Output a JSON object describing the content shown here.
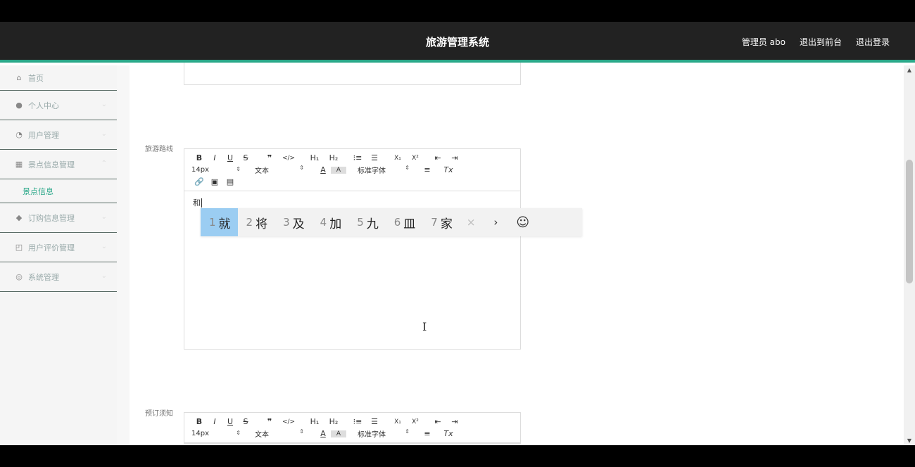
{
  "header": {
    "title": "旅游管理系统",
    "user": "管理员 abo",
    "to_front": "退出到前台",
    "logout": "退出登录"
  },
  "sidebar": {
    "items": [
      {
        "label": "首页",
        "icon": "home-icon",
        "glyph": "⌂"
      },
      {
        "label": "个人中心",
        "icon": "user-icon",
        "glyph": "●"
      },
      {
        "label": "用户管理",
        "icon": "users-icon",
        "glyph": "◔"
      },
      {
        "label": "景点信息管理",
        "icon": "scenic-icon",
        "glyph": "▦"
      },
      {
        "label": "订购信息管理",
        "icon": "order-icon",
        "glyph": "◆"
      },
      {
        "label": "用户评价管理",
        "icon": "review-icon",
        "glyph": "◰"
      },
      {
        "label": "系统管理",
        "icon": "settings-icon",
        "glyph": "◎"
      }
    ],
    "sub_item": "景点信息"
  },
  "form": {
    "route_label": "旅游路线",
    "notice_label": "预订须知",
    "typed_text": "和"
  },
  "toolbar": {
    "bold": "B",
    "italic": "I",
    "underline": "U",
    "strike": "S",
    "quote": "❞",
    "code": "</>",
    "h1": "H₁",
    "h2": "H₂",
    "ordered_list": "⁝≡",
    "bullet_list": "☰",
    "subscript": "X₁",
    "superscript": "X²",
    "outdent": "⇤",
    "indent": "⇥",
    "size_select": "14px",
    "format_select": "文本",
    "font_color": "A",
    "bg_color": "A",
    "font_select": "标准字体",
    "align": "≡",
    "clean": "Tx",
    "link": "🔗",
    "image": "▣",
    "video": "▤",
    "select_arrow": "⇕"
  },
  "ime": {
    "candidates": [
      {
        "num": "1",
        "text": "就"
      },
      {
        "num": "2",
        "text": "将"
      },
      {
        "num": "3",
        "text": "及"
      },
      {
        "num": "4",
        "text": "加"
      },
      {
        "num": "5",
        "text": "九"
      },
      {
        "num": "6",
        "text": "皿"
      },
      {
        "num": "7",
        "text": "家"
      }
    ],
    "close": "×",
    "next": "›",
    "emoji": "☺"
  },
  "colors": {
    "accent": "#2aa889",
    "header_bg": "#222222",
    "ime_selected": "#9bcdf2"
  }
}
